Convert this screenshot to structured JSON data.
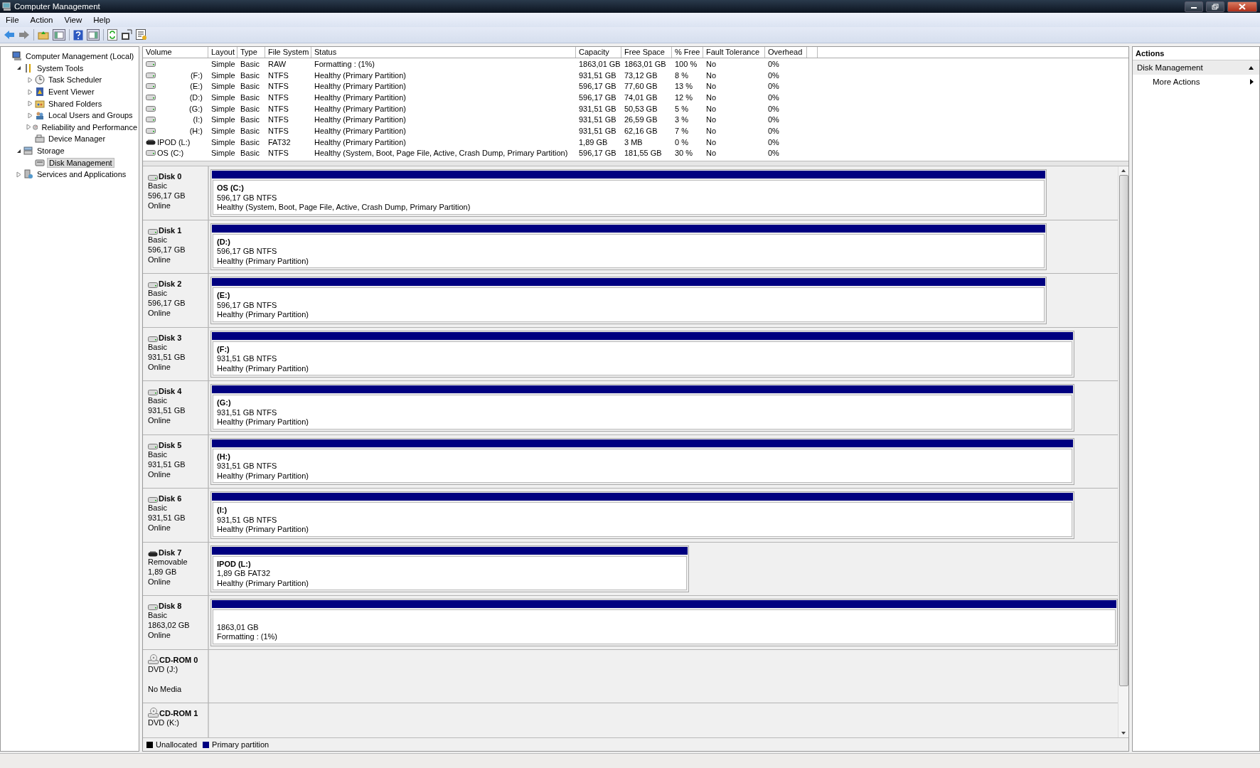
{
  "window": {
    "title": "Computer Management"
  },
  "menu": [
    {
      "label": "File"
    },
    {
      "label": "Action"
    },
    {
      "label": "View"
    },
    {
      "label": "Help"
    }
  ],
  "tree": [
    {
      "label": "Computer Management (Local)",
      "selected": false,
      "children": [
        {
          "label": "System Tools",
          "expanded": true,
          "selected": false,
          "children": [
            {
              "label": "Task Scheduler",
              "expanded": false,
              "selected": false
            },
            {
              "label": "Event Viewer",
              "expanded": false,
              "selected": false
            },
            {
              "label": "Shared Folders",
              "expanded": false,
              "selected": false
            },
            {
              "label": "Local Users and Groups",
              "expanded": false,
              "selected": false
            },
            {
              "label": "Reliability and Performance",
              "expanded": false,
              "selected": false
            },
            {
              "label": "Device Manager",
              "selected": false
            }
          ]
        },
        {
          "label": "Storage",
          "expanded": true,
          "selected": false,
          "children": [
            {
              "label": "Disk Management",
              "selected": true
            }
          ]
        },
        {
          "label": "Services and Applications",
          "expanded": false,
          "selected": false
        }
      ]
    }
  ],
  "volume_table": {
    "columns": [
      "Volume",
      "Layout",
      "Type",
      "File System",
      "Status",
      "Capacity",
      "Free Space",
      "% Free",
      "Fault Tolerance",
      "Overhead"
    ],
    "rows": [
      {
        "kind": "disk",
        "volume": "",
        "layout": "Simple",
        "type": "Basic",
        "file_system": "RAW",
        "status": "Formatting : (1%)",
        "capacity": "1863,01 GB",
        "free_space": "1863,01 GB",
        "percent_free": "100 %",
        "fault_tolerance": "No",
        "overhead": "0%"
      },
      {
        "kind": "disk",
        "volume": "(F:)",
        "layout": "Simple",
        "type": "Basic",
        "file_system": "NTFS",
        "status": "Healthy (Primary Partition)",
        "capacity": "931,51 GB",
        "free_space": "73,12 GB",
        "percent_free": "8 %",
        "fault_tolerance": "No",
        "overhead": "0%"
      },
      {
        "kind": "disk",
        "volume": "(E:)",
        "layout": "Simple",
        "type": "Basic",
        "file_system": "NTFS",
        "status": "Healthy (Primary Partition)",
        "capacity": "596,17 GB",
        "free_space": "77,60 GB",
        "percent_free": "13 %",
        "fault_tolerance": "No",
        "overhead": "0%"
      },
      {
        "kind": "disk",
        "volume": "(D:)",
        "layout": "Simple",
        "type": "Basic",
        "file_system": "NTFS",
        "status": "Healthy (Primary Partition)",
        "capacity": "596,17 GB",
        "free_space": "74,01 GB",
        "percent_free": "12 %",
        "fault_tolerance": "No",
        "overhead": "0%"
      },
      {
        "kind": "disk",
        "volume": "(G:)",
        "layout": "Simple",
        "type": "Basic",
        "file_system": "NTFS",
        "status": "Healthy (Primary Partition)",
        "capacity": "931,51 GB",
        "free_space": "50,53 GB",
        "percent_free": "5 %",
        "fault_tolerance": "No",
        "overhead": "0%"
      },
      {
        "kind": "disk",
        "volume": "(I:)",
        "layout": "Simple",
        "type": "Basic",
        "file_system": "NTFS",
        "status": "Healthy (Primary Partition)",
        "capacity": "931,51 GB",
        "free_space": "26,59 GB",
        "percent_free": "3 %",
        "fault_tolerance": "No",
        "overhead": "0%"
      },
      {
        "kind": "disk",
        "volume": "(H:)",
        "layout": "Simple",
        "type": "Basic",
        "file_system": "NTFS",
        "status": "Healthy (Primary Partition)",
        "capacity": "931,51 GB",
        "free_space": "62,16 GB",
        "percent_free": "7 %",
        "fault_tolerance": "No",
        "overhead": "0%"
      },
      {
        "kind": "removable",
        "volume": "IPOD (L:)",
        "layout": "Simple",
        "type": "Basic",
        "file_system": "FAT32",
        "status": "Healthy (Primary Partition)",
        "capacity": "1,89 GB",
        "free_space": "3 MB",
        "percent_free": "0 %",
        "fault_tolerance": "No",
        "overhead": "0%"
      },
      {
        "kind": "disk",
        "volume": "OS (C:)",
        "layout": "Simple",
        "type": "Basic",
        "file_system": "NTFS",
        "status": "Healthy (System, Boot, Page File, Active, Crash Dump, Primary Partition)",
        "capacity": "596,17 GB",
        "free_space": "181,55 GB",
        "percent_free": "30 %",
        "fault_tolerance": "No",
        "overhead": "0%"
      }
    ]
  },
  "disks": [
    {
      "kind": "disk",
      "name": "Disk 0",
      "type": "Basic",
      "capacity": "596,17 GB",
      "status": "Online",
      "partition": {
        "kind": "primary",
        "label": "OS  (C:)",
        "size": "596,17 GB NTFS",
        "status": "Healthy (System, Boot, Page File, Active, Crash Dump, Primary Partition)"
      }
    },
    {
      "kind": "disk",
      "name": "Disk 1",
      "type": "Basic",
      "capacity": "596,17 GB",
      "status": "Online",
      "partition": {
        "kind": "primary",
        "label": "(D:)",
        "size": "596,17 GB NTFS",
        "status": "Healthy (Primary Partition)"
      }
    },
    {
      "kind": "disk",
      "name": "Disk 2",
      "type": "Basic",
      "capacity": "596,17 GB",
      "status": "Online",
      "partition": {
        "kind": "primary",
        "label": "(E:)",
        "size": "596,17 GB NTFS",
        "status": "Healthy (Primary Partition)"
      }
    },
    {
      "kind": "disk",
      "name": "Disk 3",
      "type": "Basic",
      "capacity": "931,51 GB",
      "status": "Online",
      "partition": {
        "kind": "primary",
        "label": "(F:)",
        "size": "931,51 GB NTFS",
        "status": "Healthy (Primary Partition)"
      }
    },
    {
      "kind": "disk",
      "name": "Disk 4",
      "type": "Basic",
      "capacity": "931,51 GB",
      "status": "Online",
      "partition": {
        "kind": "primary",
        "label": "(G:)",
        "size": "931,51 GB NTFS",
        "status": "Healthy (Primary Partition)"
      }
    },
    {
      "kind": "disk",
      "name": "Disk 5",
      "type": "Basic",
      "capacity": "931,51 GB",
      "status": "Online",
      "partition": {
        "kind": "primary",
        "label": "(H:)",
        "size": "931,51 GB NTFS",
        "status": "Healthy (Primary Partition)"
      }
    },
    {
      "kind": "disk",
      "name": "Disk 6",
      "type": "Basic",
      "capacity": "931,51 GB",
      "status": "Online",
      "partition": {
        "kind": "primary",
        "label": "(I:)",
        "size": "931,51 GB NTFS",
        "status": "Healthy (Primary Partition)"
      }
    },
    {
      "kind": "removable",
      "name": "Disk 7",
      "type": "Removable",
      "capacity": "1,89 GB",
      "status": "Online",
      "partition": {
        "kind": "primary",
        "label": "IPOD  (L:)",
        "size": "1,89 GB FAT32",
        "status": "Healthy (Primary Partition)"
      }
    },
    {
      "kind": "disk",
      "name": "Disk 8",
      "type": "Basic",
      "capacity": "1863,02 GB",
      "status": "Online",
      "partition": {
        "kind": "primary",
        "size": "1863,01 GB",
        "status": "Formatting : (1%)"
      }
    },
    {
      "kind": "cdrom",
      "name": "CD-ROM 0",
      "type": "DVD (J:)",
      "status": "No Media"
    },
    {
      "kind": "cdrom",
      "name": "CD-ROM 1",
      "type": "DVD (K:)"
    }
  ],
  "legend": [
    {
      "label": "Unallocated",
      "color": "#000000"
    },
    {
      "label": "Primary partition",
      "color": "#000080"
    }
  ],
  "actions": {
    "title": "Actions",
    "section": "Disk Management",
    "items": [
      {
        "label": "More Actions"
      }
    ]
  }
}
